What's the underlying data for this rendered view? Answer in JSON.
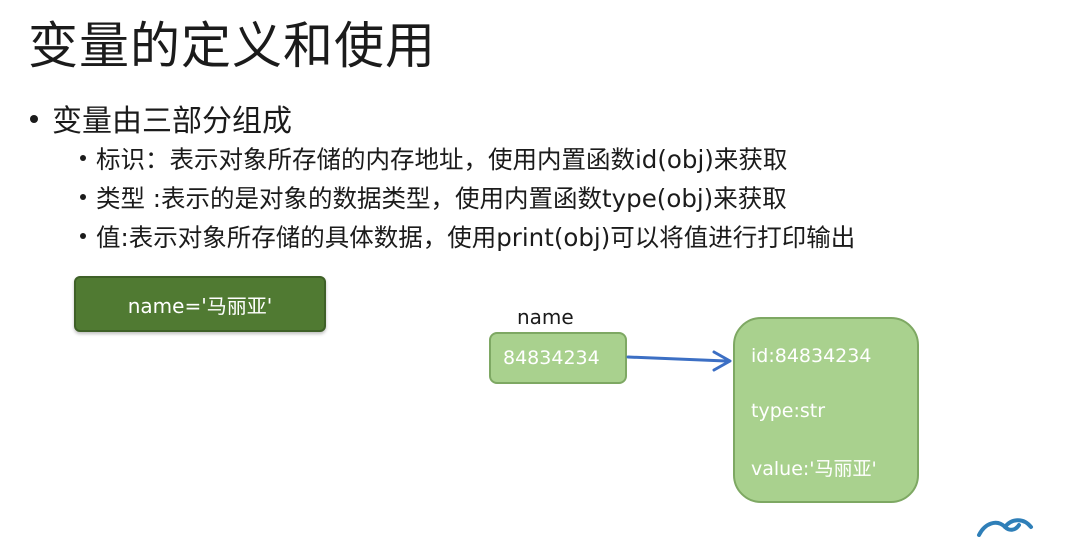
{
  "slide": {
    "title": "变量的定义和使用",
    "bullet_main": "变量由三部分组成",
    "bullets": [
      "标识：表示对象所存储的内存地址，使用内置函数id(obj)来获取",
      "类型 :表示的是对象的数据类型，使用内置函数type(obj)来获取",
      "值:表示对象所存储的具体数据，使用print(obj)可以将值进行打印输出"
    ]
  },
  "diagram": {
    "assignment": "name='马丽亚'",
    "variable_name": "name",
    "address": "84834234",
    "object": {
      "id": "id:84834234",
      "type": "type:str",
      "value": "value:'马丽亚'"
    },
    "colors": {
      "assignment_fill": "#507a32",
      "box_fill": "#a9d18e",
      "arrow": "#3c6fc4"
    }
  },
  "logo_icon": "wave-logo-icon"
}
